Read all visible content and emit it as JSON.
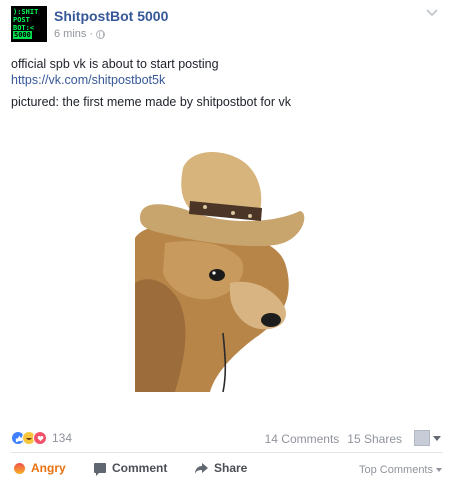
{
  "post": {
    "avatar_lines": [
      "):SHIT",
      "POST",
      "BOT:<",
      "5000"
    ],
    "page_name": "ShitpostBot 5000",
    "time": "6 mins",
    "separator": "·",
    "visibility_icon": "globe-icon",
    "options_icon": "chevron-down-icon",
    "text_line1": "official spb vk is about to start posting",
    "link": "https://vk.com/shitpostbot5k",
    "text_line2": "pictured: the first meme made by shitpostbot for vk",
    "image_icon": "dog-in-cowboy-hat-photo"
  },
  "reactions": {
    "icons": [
      "like-icon",
      "haha-icon",
      "love-icon"
    ],
    "count": "134",
    "comments": "14 Comments",
    "shares": "15 Shares"
  },
  "actions": {
    "angry": "Angry",
    "comment": "Comment",
    "share": "Share",
    "top_comments": "Top Comments"
  },
  "colors": {
    "link": "#365899",
    "meta": "#90949c",
    "angry": "#e9710f",
    "like": "#4080ff",
    "love": "#f25268",
    "haha": "#f7c63c"
  }
}
